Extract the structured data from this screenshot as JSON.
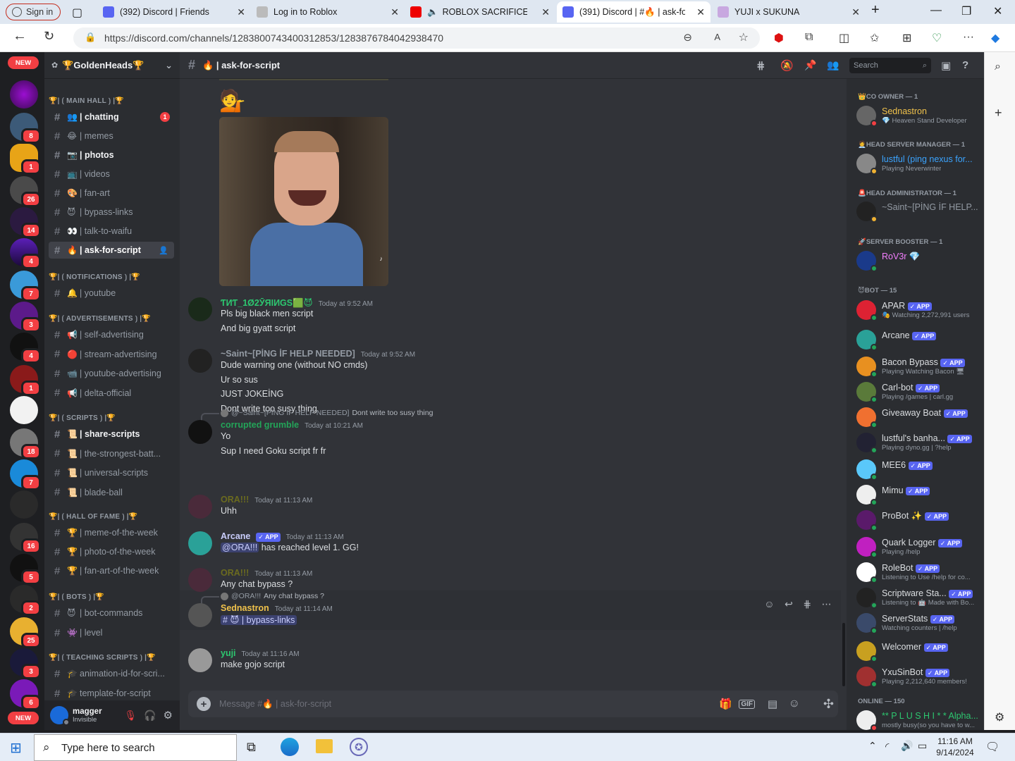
{
  "browser": {
    "signin": "Sign in",
    "tabs": [
      {
        "title": "(392) Discord | Friends"
      },
      {
        "title": "Log in to Roblox"
      },
      {
        "title": "ROBLOX SACRIFICE SAN"
      },
      {
        "title": "(391) Discord | #🔥 | ask-for-"
      },
      {
        "title": "YUJI x SUKUNA"
      }
    ],
    "url": "https://discord.com/channels/1283800743400312853/1283876784042938470"
  },
  "guilds": {
    "new_label": "NEW",
    "badges": [
      "8",
      "1",
      "26",
      "14",
      "4",
      "7",
      "3",
      "4",
      "1",
      "18",
      "7",
      "16",
      "5",
      "2",
      "25",
      "3",
      "6"
    ]
  },
  "server": {
    "name": "🏆GoldenHeads🏆",
    "categories": [
      {
        "name": "🏆| ⟮ MAIN HALL ⟯ |🏆",
        "channels": [
          {
            "emoji": "👥",
            "name": "| chatting",
            "badge": "1"
          },
          {
            "emoji": "😂",
            "name": "| memes"
          },
          {
            "emoji": "📷",
            "name": "| photos"
          },
          {
            "emoji": "📺",
            "name": "| videos"
          },
          {
            "emoji": "🎨",
            "name": "| fan-art"
          },
          {
            "emoji": "😈",
            "name": "| bypass-links"
          },
          {
            "emoji": "👀",
            "name": "| talk-to-waifu"
          },
          {
            "emoji": "🔥",
            "name": "| ask-for-script"
          }
        ]
      },
      {
        "name": "🏆| ⟮ NOTIFICATIONS ⟯ |🏆",
        "channels": [
          {
            "emoji": "🔔",
            "name": "| youtube"
          }
        ]
      },
      {
        "name": "🏆| ⟮ ADVERTISEMENTS ⟯ |🏆",
        "channels": [
          {
            "emoji": "📢",
            "name": "| self-advertising"
          },
          {
            "emoji": "🔴",
            "name": "| stream-advertising"
          },
          {
            "emoji": "📹",
            "name": "| youtube-advertising"
          },
          {
            "emoji": "📢",
            "name": "| delta-official"
          }
        ]
      },
      {
        "name": "🏆| ⟮ SCRIPTS ⟯ |🏆",
        "channels": [
          {
            "emoji": "📜",
            "name": "| share-scripts"
          },
          {
            "emoji": "📜",
            "name": "| the-strongest-batt..."
          },
          {
            "emoji": "📜",
            "name": "| universal-scripts"
          },
          {
            "emoji": "📜",
            "name": "| blade-ball"
          }
        ]
      },
      {
        "name": "🏆| ⟮ HALL OF FAME ⟯ |🏆",
        "channels": [
          {
            "emoji": "🏆",
            "name": "| meme-of-the-week"
          },
          {
            "emoji": "🏆",
            "name": "| photo-of-the-week"
          },
          {
            "emoji": "🏆",
            "name": "| fan-art-of-the-week"
          }
        ]
      },
      {
        "name": "🏆| ⟮ BOTS ⟯ |🏆",
        "channels": [
          {
            "emoji": "😈",
            "name": "| bot-commands"
          },
          {
            "emoji": "👾",
            "name": "| level"
          }
        ]
      },
      {
        "name": "🏆| ⟮ TEACHING SCRIPTS ⟯ |🏆",
        "channels": [
          {
            "emoji": "🎓",
            "name": "animation-id-for-scri..."
          },
          {
            "emoji": "🎓",
            "name": "template-for-script"
          }
        ]
      }
    ]
  },
  "user": {
    "name": "magger",
    "status": "Invisible"
  },
  "channel": {
    "title": "🔥 | ask-for-script",
    "search_placeholder": "Search",
    "composer_placeholder": "Message #🔥 | ask-for-script"
  },
  "messages": [
    {
      "author": "ƬИƬ_1Ø2ӮЯIИGS🟩😈",
      "time": "Today at 9:52 AM",
      "color": "#2dc770",
      "lines": [
        "Pls big black men script",
        "And big gyatt script"
      ]
    },
    {
      "author": "~Saint~[PİNG İF HELP NEEDED]",
      "time": "Today at 9:52 AM",
      "color": "#949ba4",
      "lines": [
        "Dude warning one (without NO cmds)",
        "Ur so sus",
        "JUST JOKEİNG",
        "Dont write too susy thing"
      ]
    },
    {
      "reply_to": "@~Saint~[PİNG İF HELP NEEDED]",
      "reply_text": "Dont write too susy thing",
      "author": "corrupted grumble",
      "time": "Today at 10:21 AM",
      "color": "#23a559",
      "lines": [
        "Yo",
        "Sup I need Goku script fr fr"
      ]
    },
    {
      "author": "ORA!!!",
      "time": "Today at 11:13 AM",
      "color": "#6b6b1f",
      "lines": [
        "Uhh"
      ]
    },
    {
      "author": "Arcane",
      "app": "✓ APP",
      "time": "Today at 11:13 AM",
      "color": "#c9cdfb",
      "mention": "@ORA!!!",
      "lines": [
        "has reached level 1. GG!"
      ]
    },
    {
      "author": "ORA!!!",
      "time": "Today at 11:13 AM",
      "color": "#6b6b1f",
      "lines": [
        "Any chat bypass ?"
      ]
    },
    {
      "reply_to": "@ORA!!!",
      "reply_text": "Any chat bypass ?",
      "author": "Sednastron",
      "time": "Today at 11:14 AM",
      "color": "#f0c24b",
      "channel_link": "# 😈 | bypass-links"
    },
    {
      "author": "yuji",
      "time": "Today at 11:16 AM",
      "color": "#2dc770",
      "lines": [
        "make gojo script"
      ]
    }
  ],
  "members": {
    "roles": [
      {
        "name": "👑CO OWNER — 1",
        "list": [
          {
            "name": "Sednastron",
            "sub": "💎 Heaven Stand Developer",
            "color": "#f0c24b",
            "status": "#f23f43"
          }
        ]
      },
      {
        "name": "🧑‍💼HEAD SERVER MANAGER — 1",
        "list": [
          {
            "name": "lustful (ping nexus for...",
            "sub": "Playing Neverwinter",
            "color": "#3ba4ff",
            "status": "#f0b232"
          }
        ]
      },
      {
        "name": "🚨HEAD ADMINISTRATOR — 1",
        "list": [
          {
            "name": "~Saint~[PİNG İF HELP...",
            "sub": "",
            "color": "#949ba4",
            "status": "#f0b232"
          }
        ]
      },
      {
        "name": "🚀SERVER BOOSTER — 1",
        "list": [
          {
            "name": "RoV3r 💎",
            "sub": "",
            "color": "#f47fff",
            "status": "#23a559"
          }
        ]
      },
      {
        "name": "😈BOT — 15",
        "list": [
          {
            "name": "APAR",
            "app": "✓ APP",
            "sub": "🎭 Watching 2,272,991 users",
            "color": "#dbdee1",
            "status": "#23a559"
          },
          {
            "name": "Arcane",
            "app": "✓ APP",
            "sub": "",
            "color": "#dbdee1",
            "status": "#23a559"
          },
          {
            "name": "Bacon Bypass",
            "app": "✓ APP",
            "sub": "Playing Watching Bacon 🖥",
            "color": "#dbdee1",
            "status": "#23a559"
          },
          {
            "name": "Carl-bot",
            "app": "✓ APP",
            "sub": "Playing /games | carl.gg",
            "color": "#dbdee1",
            "status": "#23a559"
          },
          {
            "name": "Giveaway Boat",
            "app": "✓ APP",
            "sub": "",
            "color": "#dbdee1",
            "status": "#23a559"
          },
          {
            "name": "lustful's banha...",
            "app": "✓ APP",
            "sub": "Playing dyno.gg | ?help",
            "color": "#dbdee1",
            "status": "#23a559"
          },
          {
            "name": "MEE6",
            "app": "✓ APP",
            "sub": "",
            "color": "#dbdee1",
            "status": "#23a559"
          },
          {
            "name": "Mimu",
            "app": "✓ APP",
            "sub": "",
            "color": "#dbdee1",
            "status": "#23a559"
          },
          {
            "name": "ProBot ✨",
            "app": "✓ APP",
            "sub": "",
            "color": "#dbdee1",
            "status": "#23a559"
          },
          {
            "name": "Quark Logger",
            "app": "✓ APP",
            "sub": "Playing /help",
            "color": "#dbdee1",
            "status": "#23a559"
          },
          {
            "name": "RoleBot",
            "app": "✓ APP",
            "sub": "Listening to Use /help for co...",
            "color": "#dbdee1",
            "status": "#23a559"
          },
          {
            "name": "Scriptware Sta...",
            "app": "✓ APP",
            "sub": "Listening to 🤖 Made with Bo...",
            "color": "#dbdee1",
            "status": "#23a559"
          },
          {
            "name": "ServerStats",
            "app": "✓ APP",
            "sub": "Watching counters | /help",
            "color": "#dbdee1",
            "status": "#23a559"
          },
          {
            "name": "Welcomer",
            "app": "✓ APP",
            "sub": "",
            "color": "#dbdee1",
            "status": "#23a559"
          },
          {
            "name": "YxuSinBot",
            "app": "✓ APP",
            "sub": "Playing 2,212,640 members!",
            "color": "#dbdee1",
            "status": "#23a559"
          }
        ]
      },
      {
        "name": "ONLINE — 150",
        "list": [
          {
            "name": "** P L U S H I * * Alpha...",
            "sub": "mostly busy(so you have to w...",
            "color": "#2dc770",
            "status": "#f23f43"
          }
        ]
      }
    ]
  },
  "taskbar": {
    "search_placeholder": "Type here to search",
    "time": "11:16 AM",
    "date": "9/14/2024"
  }
}
